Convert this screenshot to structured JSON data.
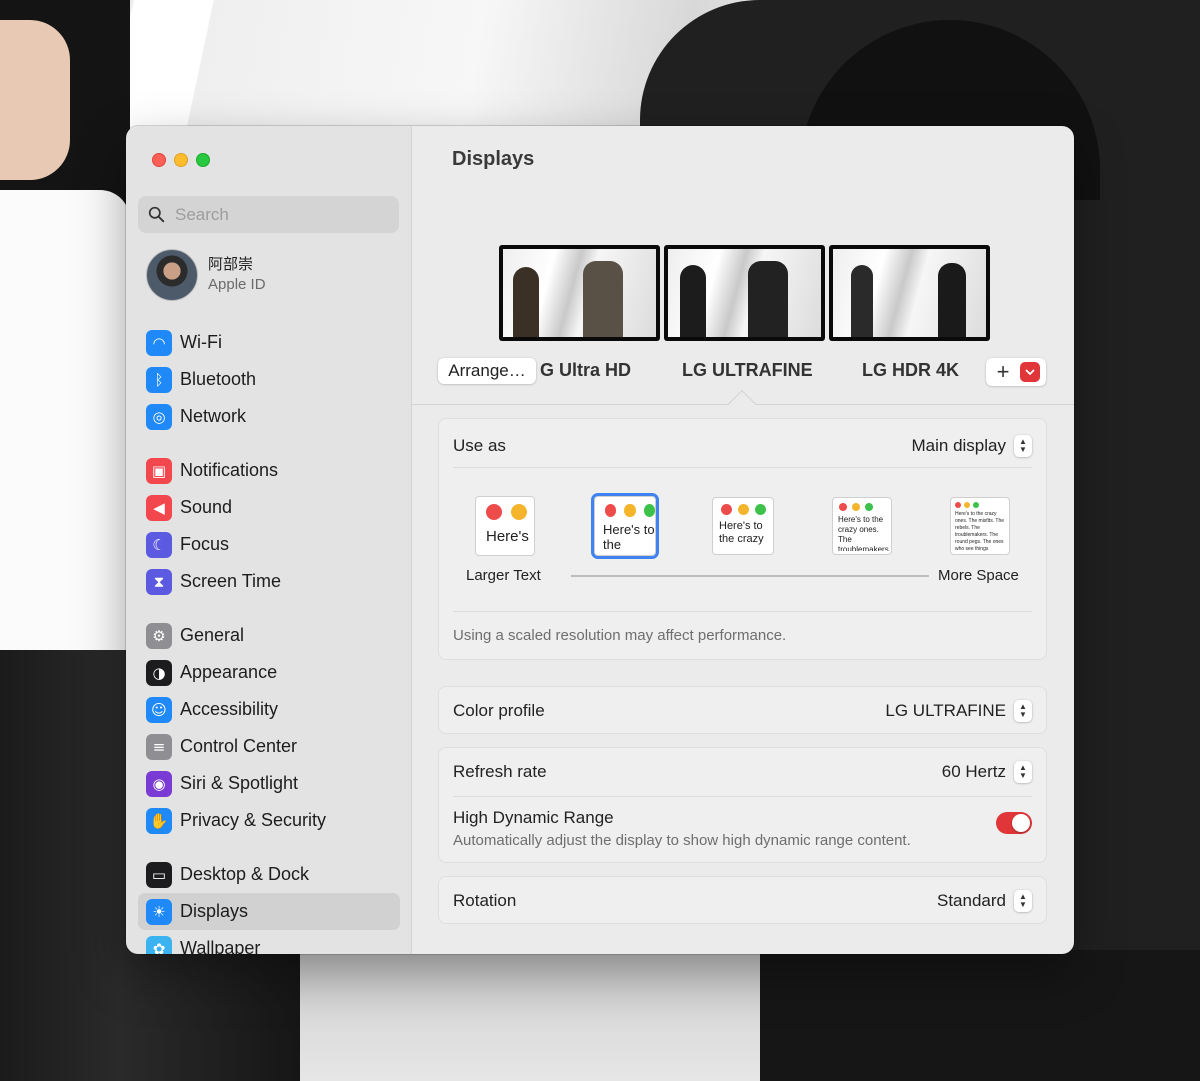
{
  "window": {
    "title": "Displays"
  },
  "sidebar": {
    "search_placeholder": "Search",
    "account": {
      "name": "阿部崇",
      "subtitle": "Apple ID"
    },
    "groups": [
      [
        {
          "label": "Wi-Fi",
          "icon": "wifi-icon",
          "color": "#1f8af7"
        },
        {
          "label": "Bluetooth",
          "icon": "bluetooth-icon",
          "color": "#1f8af7"
        },
        {
          "label": "Network",
          "icon": "globe-icon",
          "color": "#1f8af7"
        }
      ],
      [
        {
          "label": "Notifications",
          "icon": "bell-icon",
          "color": "#f2484d"
        },
        {
          "label": "Sound",
          "icon": "speaker-icon",
          "color": "#f2484d"
        },
        {
          "label": "Focus",
          "icon": "moon-icon",
          "color": "#5b5ae0"
        },
        {
          "label": "Screen Time",
          "icon": "hourglass-icon",
          "color": "#5b5ae0"
        }
      ],
      [
        {
          "label": "General",
          "icon": "gear-icon",
          "color": "#8e8e93"
        },
        {
          "label": "Appearance",
          "icon": "appearance-icon",
          "color": "#1c1c1e"
        },
        {
          "label": "Accessibility",
          "icon": "accessibility-icon",
          "color": "#1f8af7"
        },
        {
          "label": "Control Center",
          "icon": "toggles-icon",
          "color": "#8e8e93"
        },
        {
          "label": "Siri & Spotlight",
          "icon": "siri-icon",
          "color": "#7a3bd4"
        },
        {
          "label": "Privacy & Security",
          "icon": "hand-icon",
          "color": "#1f8af7"
        }
      ],
      [
        {
          "label": "Desktop & Dock",
          "icon": "dock-icon",
          "color": "#1c1c1e"
        },
        {
          "label": "Displays",
          "icon": "sun-icon",
          "color": "#1f8af7",
          "active": true
        },
        {
          "label": "Wallpaper",
          "icon": "flower-icon",
          "color": "#3ab3f0"
        }
      ]
    ]
  },
  "displays": {
    "arrange_label": "Arrange…",
    "list": [
      {
        "name": "LG Ultra HD",
        "visible_name": "G Ultra HD"
      },
      {
        "name": "LG ULTRAFINE",
        "visible_name": "LG ULTRAFINE",
        "selected": true
      },
      {
        "name": "LG HDR 4K",
        "visible_name": "LG HDR 4K"
      }
    ],
    "add_label": "+"
  },
  "use_as": {
    "label": "Use as",
    "value": "Main display"
  },
  "resolution": {
    "options": [
      {
        "sample": "Here's"
      },
      {
        "sample": "Here's to the crazy ones, troublemakers",
        "selected": true
      },
      {
        "sample": "Here's to the crazy ones, troublemakers, ones who see things differently"
      },
      {
        "sample": "Here's to the crazy ones. The troublemakers. The ones who see things differently. They're not fond of rules. And they have no respect"
      },
      {
        "sample": "Here's to the crazy ones. The misfits. The rebels. The troublemakers. The round pegs. The ones who see things differently. They're not fond of rules. And they have no respect for the status quo. You can quote them, disagree with them. About the only thing you can't do is ignore them. Because they change things"
      }
    ],
    "min_label": "Larger Text",
    "max_label": "More Space",
    "note": "Using a scaled resolution may affect performance."
  },
  "color_profile": {
    "label": "Color profile",
    "value": "LG ULTRAFINE"
  },
  "refresh_rate": {
    "label": "Refresh rate",
    "value": "60 Hertz"
  },
  "hdr": {
    "title": "High Dynamic Range",
    "description": "Automatically adjust the display to show high dynamic range content.",
    "enabled": true
  },
  "rotation": {
    "label": "Rotation",
    "value": "Standard"
  }
}
